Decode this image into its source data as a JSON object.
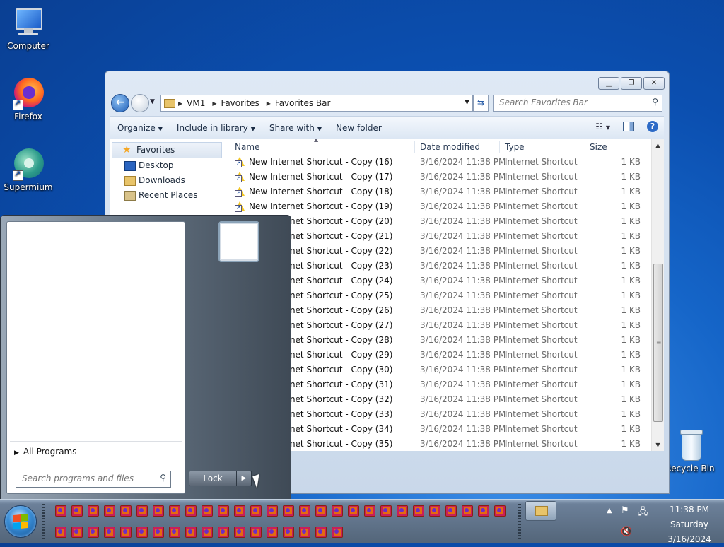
{
  "desktop": {
    "icons": [
      {
        "label": "Computer"
      },
      {
        "label": "Firefox"
      },
      {
        "label": "Supermium"
      },
      {
        "label": "Recycle Bin"
      }
    ]
  },
  "window": {
    "breadcrumb": [
      "VM1",
      "Favorites",
      "Favorites Bar"
    ],
    "search_placeholder": "Search Favorites Bar",
    "toolbar": {
      "organize": "Organize",
      "include_in_library": "Include in library",
      "share_with": "Share with",
      "new_folder": "New folder"
    },
    "navpane": {
      "favorites": "Favorites",
      "items": [
        "Desktop",
        "Downloads",
        "Recent Places"
      ]
    },
    "columns": {
      "name": "Name",
      "date_modified": "Date modified",
      "type": "Type",
      "size": "Size"
    },
    "rows": [
      {
        "name": "New Internet Shortcut - Copy (16)",
        "date": "3/16/2024 11:38 PM",
        "type": "Internet Shortcut",
        "size": "1 KB"
      },
      {
        "name": "New Internet Shortcut - Copy (17)",
        "date": "3/16/2024 11:38 PM",
        "type": "Internet Shortcut",
        "size": "1 KB"
      },
      {
        "name": "New Internet Shortcut - Copy (18)",
        "date": "3/16/2024 11:38 PM",
        "type": "Internet Shortcut",
        "size": "1 KB"
      },
      {
        "name": "New Internet Shortcut - Copy (19)",
        "date": "3/16/2024 11:38 PM",
        "type": "Internet Shortcut",
        "size": "1 KB"
      },
      {
        "name": "New Internet Shortcut - Copy (20)",
        "date": "3/16/2024 11:38 PM",
        "type": "Internet Shortcut",
        "size": "1 KB"
      },
      {
        "name": "New Internet Shortcut - Copy (21)",
        "date": "3/16/2024 11:38 PM",
        "type": "Internet Shortcut",
        "size": "1 KB"
      },
      {
        "name": "New Internet Shortcut - Copy (22)",
        "date": "3/16/2024 11:38 PM",
        "type": "Internet Shortcut",
        "size": "1 KB"
      },
      {
        "name": "New Internet Shortcut - Copy (23)",
        "date": "3/16/2024 11:38 PM",
        "type": "Internet Shortcut",
        "size": "1 KB"
      },
      {
        "name": "New Internet Shortcut - Copy (24)",
        "date": "3/16/2024 11:38 PM",
        "type": "Internet Shortcut",
        "size": "1 KB"
      },
      {
        "name": "New Internet Shortcut - Copy (25)",
        "date": "3/16/2024 11:38 PM",
        "type": "Internet Shortcut",
        "size": "1 KB"
      },
      {
        "name": "New Internet Shortcut - Copy (26)",
        "date": "3/16/2024 11:38 PM",
        "type": "Internet Shortcut",
        "size": "1 KB"
      },
      {
        "name": "New Internet Shortcut - Copy (27)",
        "date": "3/16/2024 11:38 PM",
        "type": "Internet Shortcut",
        "size": "1 KB"
      },
      {
        "name": "New Internet Shortcut - Copy (28)",
        "date": "3/16/2024 11:38 PM",
        "type": "Internet Shortcut",
        "size": "1 KB"
      },
      {
        "name": "New Internet Shortcut - Copy (29)",
        "date": "3/16/2024 11:38 PM",
        "type": "Internet Shortcut",
        "size": "1 KB"
      },
      {
        "name": "New Internet Shortcut - Copy (30)",
        "date": "3/16/2024 11:38 PM",
        "type": "Internet Shortcut",
        "size": "1 KB"
      },
      {
        "name": "New Internet Shortcut - Copy (31)",
        "date": "3/16/2024 11:38 PM",
        "type": "Internet Shortcut",
        "size": "1 KB"
      },
      {
        "name": "New Internet Shortcut - Copy (32)",
        "date": "3/16/2024 11:38 PM",
        "type": "Internet Shortcut",
        "size": "1 KB"
      },
      {
        "name": "New Internet Shortcut - Copy (33)",
        "date": "3/16/2024 11:38 PM",
        "type": "Internet Shortcut",
        "size": "1 KB"
      },
      {
        "name": "New Internet Shortcut - Copy (34)",
        "date": "3/16/2024 11:38 PM",
        "type": "Internet Shortcut",
        "size": "1 KB"
      },
      {
        "name": "New Internet Shortcut - Copy (35)",
        "date": "3/16/2024 11:38 PM",
        "type": "Internet Shortcut",
        "size": "1 KB"
      }
    ]
  },
  "startmenu": {
    "all_programs": "All Programs",
    "search_placeholder": "Search programs and files",
    "lock_label": "Lock"
  },
  "taskbar": {
    "pinned_icon": "app-icon",
    "clock": {
      "time": "11:38 PM",
      "day": "Saturday",
      "date": "3/16/2024"
    }
  },
  "colors": {
    "desktop_blue": "#1565c8",
    "shortcut_yellow": "#f2c624",
    "taskbar": "#536579"
  }
}
